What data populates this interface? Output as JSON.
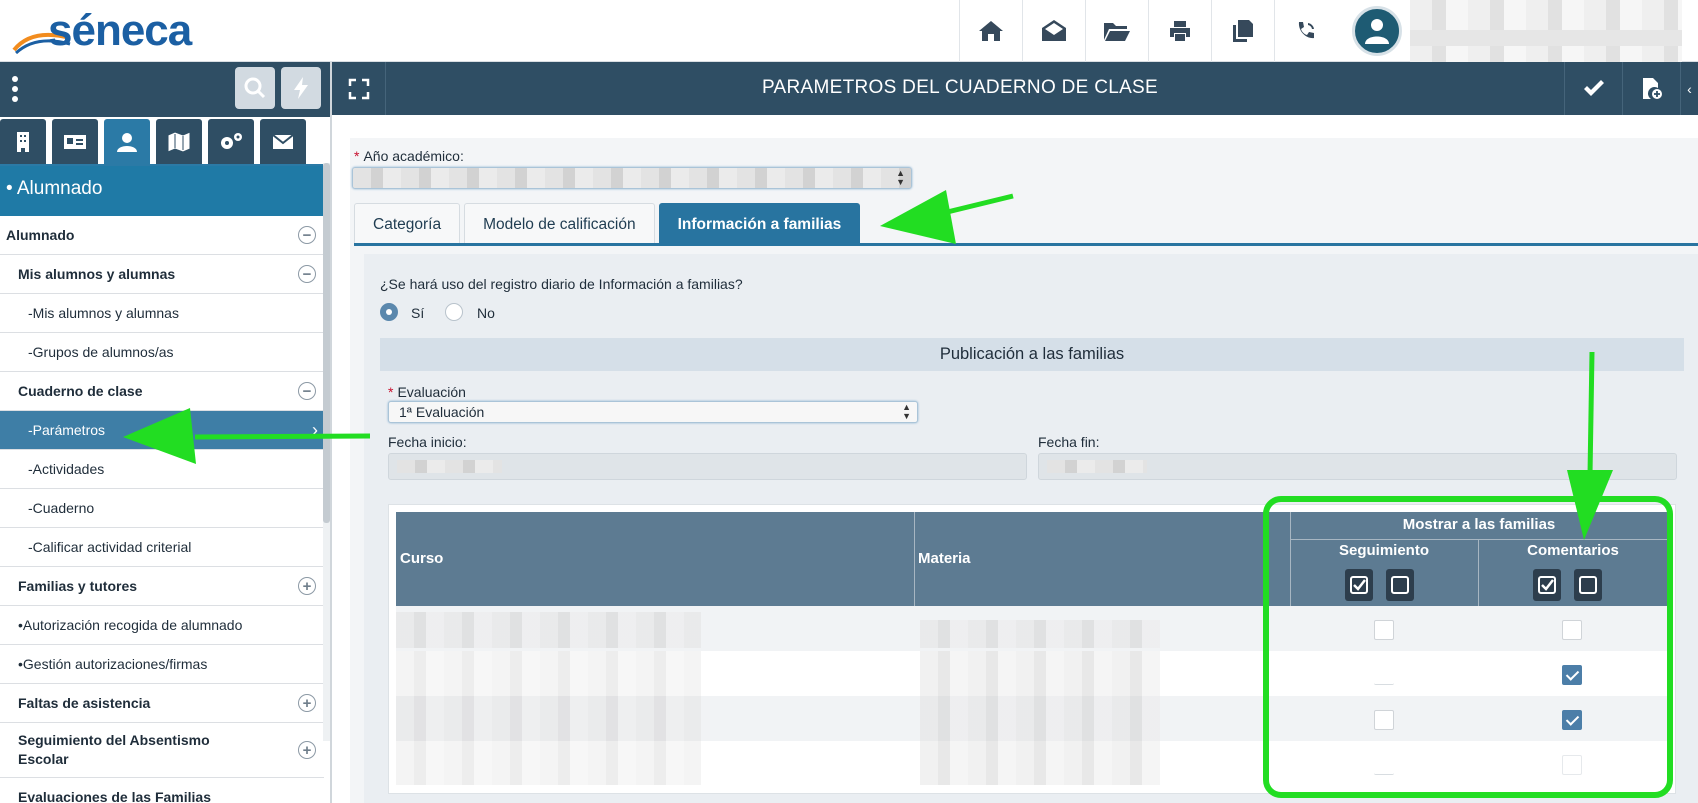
{
  "app": {
    "logo_text": "séneca",
    "page_title": "PARAMETROS DEL CUADERNO DE CLASE"
  },
  "topbar": {
    "icons": [
      "home-icon",
      "mail-open-icon",
      "folder-open-icon",
      "print-icon",
      "copy-icon",
      "phone-icon"
    ],
    "user_avatar": "user-avatar-icon"
  },
  "sidebar": {
    "section_title": "• Alumnado",
    "tabs": [
      "building-icon",
      "id-card-icon",
      "students-icon",
      "map-icon",
      "settings-icon",
      "envelope-icon"
    ],
    "active_tab_index": 2,
    "items": [
      {
        "label": "Alumnado",
        "level": "lvl0",
        "toggle": "−"
      },
      {
        "label": "Mis alumnos y alumnas",
        "level": "lvl1",
        "toggle": "−"
      },
      {
        "label": "-Mis alumnos y alumnas",
        "level": "lvl2"
      },
      {
        "label": "-Grupos de alumnos/as",
        "level": "lvl2"
      },
      {
        "label": "Cuaderno de clase",
        "level": "lvl1",
        "toggle": "−"
      },
      {
        "label": "-Parámetros",
        "level": "lvl2",
        "active": true
      },
      {
        "label": "-Actividades",
        "level": "lvl2"
      },
      {
        "label": "-Cuaderno",
        "level": "lvl2"
      },
      {
        "label": "-Calificar actividad criterial",
        "level": "lvl2"
      },
      {
        "label": "Familias y tutores",
        "level": "lvl1",
        "toggle": "+"
      },
      {
        "label": "•Autorización recogida de alumnado",
        "level": "dot"
      },
      {
        "label": "•Gestión autorizaciones/firmas",
        "level": "dot"
      },
      {
        "label": "Faltas de asistencia",
        "level": "lvl1",
        "toggle": "+"
      },
      {
        "label": "Seguimiento del Absentismo\n Escolar",
        "level": "lvl1",
        "toggle": "+",
        "tall": true
      },
      {
        "label": "Evaluaciones de las Familias",
        "level": "lvl1"
      }
    ]
  },
  "form": {
    "year_label": "Año académico:",
    "tabs": [
      "Categoría",
      "Modelo de calificación",
      "Información a familias"
    ],
    "active_tab_index": 2,
    "question": "¿Se hará uso del registro diario de Información a familias?",
    "radio_yes": "Sí",
    "radio_no": "No",
    "radio_selected": "Sí",
    "publication_title": "Publicación a las familias",
    "evaluation_label": "Evaluación",
    "evaluation_value": "1ª Evaluación",
    "start_label": "Fecha inicio:",
    "end_label": "Fecha fin:"
  },
  "table": {
    "col_course": "Curso",
    "col_subject": "Materia",
    "col_show": "Mostrar a las familias",
    "col_tracking": "Seguimiento",
    "col_comments": "Comentarios",
    "rows": [
      {
        "seguimiento": "unchecked",
        "comentarios": "unchecked"
      },
      {
        "seguimiento": "faint",
        "comentarios": "checked"
      },
      {
        "seguimiento": "unchecked",
        "comentarios": "checked"
      },
      {
        "seguimiento": "faint",
        "comentarios": "faint"
      }
    ]
  },
  "colors": {
    "header_dark": "#2f4e64",
    "accent_blue": "#2874a0",
    "annotation_green": "#22dd22"
  }
}
